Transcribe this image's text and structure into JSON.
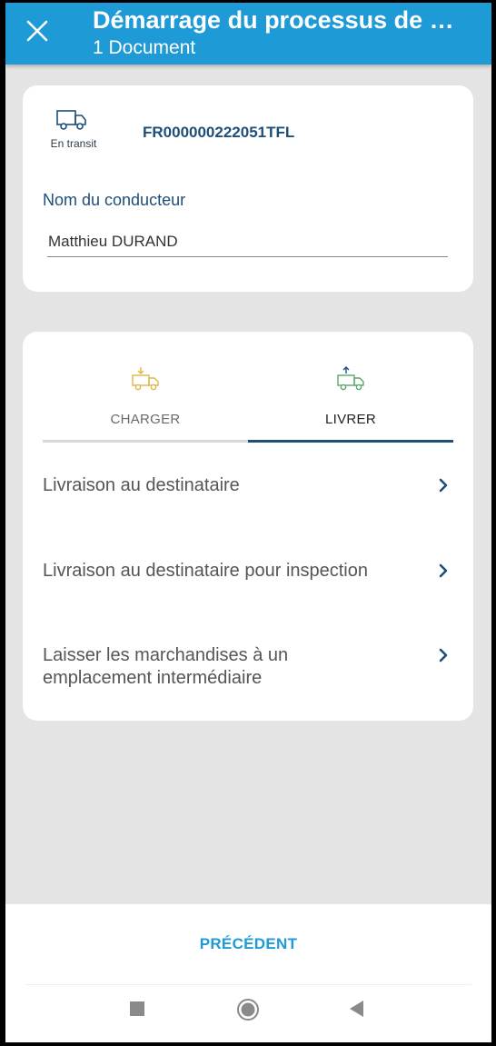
{
  "header": {
    "title": "Démarrage du processus de si...",
    "subtitle": "1 Document"
  },
  "document": {
    "status": "En transit",
    "number": "FR000000222051TFL",
    "driver_label": "Nom du conducteur",
    "driver_name": "Matthieu DURAND"
  },
  "tabs": [
    {
      "label": "CHARGER",
      "icon": "truck-load-icon",
      "color": "#e0b64a",
      "active": false
    },
    {
      "label": "LIVRER",
      "icon": "truck-unload-icon",
      "color": "#5aa86a",
      "active": true
    }
  ],
  "options": [
    {
      "label": "Livraison au destinataire"
    },
    {
      "label": "Livraison au destinataire pour inspection"
    },
    {
      "label": "Laisser les marchandises à un emplacement intermédiaire"
    }
  ],
  "footer": {
    "previous_label": "PRÉCÉDENT"
  },
  "colors": {
    "appbar": "#1e9ad6",
    "accent_dark": "#1f4e79",
    "background": "#e4e4e4"
  }
}
